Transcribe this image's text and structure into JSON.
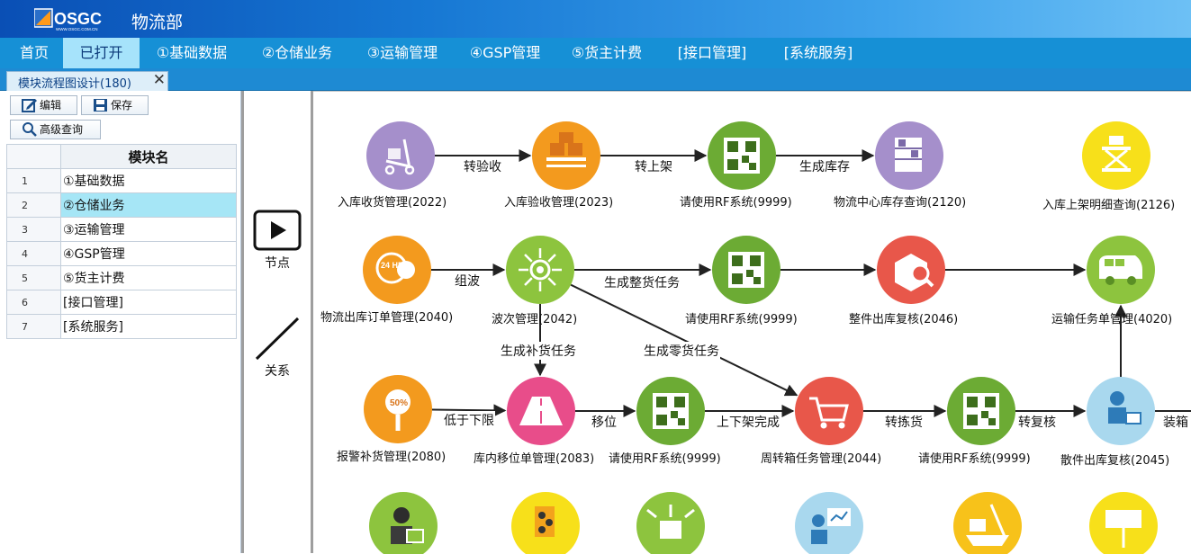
{
  "header": {
    "logo_text": "OSGC",
    "logo_subtext": "WWW.OSGC.COM.CN",
    "department": "物流部",
    "colors": {
      "brand_dark": "#0a4fb5",
      "brand_light": "#6dc0f5"
    }
  },
  "menu": {
    "items": [
      {
        "label": "首页"
      },
      {
        "label": "已打开",
        "active": true
      },
      {
        "label": "①基础数据"
      },
      {
        "label": "②仓储业务"
      },
      {
        "label": "③运输管理"
      },
      {
        "label": "④GSP管理"
      },
      {
        "label": "⑤货主计费"
      },
      {
        "label": "[接口管理]"
      },
      {
        "label": "[系统服务]"
      }
    ]
  },
  "tab": {
    "label": "模块流程图设计(180)",
    "close_icon": "close-icon"
  },
  "toolbar": {
    "edit_label": "编辑",
    "edit_icon": "edit-icon",
    "save_label": "保存",
    "save_icon": "save-icon",
    "search_label": "高级查询",
    "search_icon": "search-icon"
  },
  "module_table": {
    "header": "模块名",
    "rows": [
      {
        "num": "1",
        "name": "①基础数据"
      },
      {
        "num": "2",
        "name": "②仓储业务",
        "selected": true
      },
      {
        "num": "3",
        "name": "③运输管理"
      },
      {
        "num": "4",
        "name": "④GSP管理"
      },
      {
        "num": "5",
        "name": "⑤货主计费"
      },
      {
        "num": "6",
        "name": "[接口管理]"
      },
      {
        "num": "7",
        "name": "[系统服务]"
      }
    ]
  },
  "palette": {
    "node_label": "节点",
    "node_icon": "play-icon",
    "relation_label": "关系",
    "relation_icon": "line-icon"
  },
  "flow": {
    "nodes": [
      {
        "id": "n2022",
        "label": "入库收货管理(2022)",
        "color": "#a58fcb",
        "icon": "hand-truck-icon"
      },
      {
        "id": "n2023",
        "label": "入库验收管理(2023)",
        "color": "#f39a1e",
        "icon": "pallet-boxes-icon"
      },
      {
        "id": "n9999a",
        "label": "请使用RF系统(9999)",
        "color": "#6cab34",
        "icon": "qr-code-icon"
      },
      {
        "id": "n2120",
        "label": "物流中心库存查询(2120)",
        "color": "#a58fcb",
        "icon": "shelf-icon"
      },
      {
        "id": "n2126",
        "label": "入库上架明细查询(2126)",
        "color": "#f7e01a",
        "icon": "lift-table-icon"
      },
      {
        "id": "n2040",
        "label": "物流出库订单管理(2040)",
        "color": "#f39a1e",
        "icon": "24hrs-service-icon"
      },
      {
        "id": "n2042",
        "label": "波次管理(2042)",
        "color": "#8dc43e",
        "icon": "distribution-hub-icon"
      },
      {
        "id": "n9999b",
        "label": "请使用RF系统(9999)",
        "color": "#6cab34",
        "icon": "qr-code-icon"
      },
      {
        "id": "n2046",
        "label": "整件出库复核(2046)",
        "color": "#e8574a",
        "icon": "box-inspect-icon"
      },
      {
        "id": "n4020",
        "label": "运输任务单管理(4020)",
        "color": "#8dc43e",
        "icon": "van-icon"
      },
      {
        "id": "n2080",
        "label": "报警补货管理(2080)",
        "color": "#f39a1e",
        "icon": "alert-50-icon"
      },
      {
        "id": "n2083",
        "label": "库内移位单管理(2083)",
        "color": "#e84d8a",
        "icon": "road-icon"
      },
      {
        "id": "n9999c",
        "label": "请使用RF系统(9999)",
        "color": "#6cab34",
        "icon": "qr-code-icon"
      },
      {
        "id": "n2044",
        "label": "周转箱任务管理(2044)",
        "color": "#e8574a",
        "icon": "shopping-cart-icon"
      },
      {
        "id": "n9999d",
        "label": "请使用RF系统(9999)",
        "color": "#6cab34",
        "icon": "qr-code-icon"
      },
      {
        "id": "n2045",
        "label": "散件出库复核(2045)",
        "color": "#a9d8ee",
        "icon": "worker-cart-icon"
      },
      {
        "id": "r4a",
        "label": "",
        "color": "#8dc43e",
        "icon": "worker-laptop-icon"
      },
      {
        "id": "r4b",
        "label": "",
        "color": "#f7e01a",
        "icon": "document-hand-icon"
      },
      {
        "id": "r4c",
        "label": "",
        "color": "#8dc43e",
        "icon": "open-box-icon"
      },
      {
        "id": "r4d",
        "label": "",
        "color": "#a9d8ee",
        "icon": "presenter-chart-icon"
      },
      {
        "id": "r4e",
        "label": "",
        "color": "#f7c21a",
        "icon": "ship-crane-icon"
      },
      {
        "id": "r4f",
        "label": "",
        "color": "#f7e01a",
        "icon": "billboard-icon"
      }
    ],
    "edges": [
      {
        "from": "n2022",
        "to": "n2023",
        "label": "转验收"
      },
      {
        "from": "n2023",
        "to": "n9999a",
        "label": "转上架"
      },
      {
        "from": "n9999a",
        "to": "n2120",
        "label": "生成库存"
      },
      {
        "from": "n2040",
        "to": "n2042",
        "label": "组波"
      },
      {
        "from": "n2042",
        "to": "n9999b",
        "label": "生成整货任务"
      },
      {
        "from": "n9999b",
        "to": "n2046",
        "label": ""
      },
      {
        "from": "n2046",
        "to": "n4020",
        "label": ""
      },
      {
        "from": "n2042",
        "to": "n2083",
        "label": "生成补货任务"
      },
      {
        "from": "n2042",
        "to": "n2044",
        "label": "生成零货任务"
      },
      {
        "from": "n2080",
        "to": "n2083",
        "label": "低于下限"
      },
      {
        "from": "n2083",
        "to": "n9999c",
        "label": "移位"
      },
      {
        "from": "n9999c",
        "to": "n2044",
        "label": "上下架完成"
      },
      {
        "from": "n2044",
        "to": "n9999d",
        "label": "转拣货"
      },
      {
        "from": "n9999d",
        "to": "n2045",
        "label": "转复核"
      },
      {
        "from": "n2045",
        "to": "n4020",
        "label": ""
      },
      {
        "from": "n2045",
        "to": "offscreen",
        "label": "装箱"
      }
    ]
  }
}
